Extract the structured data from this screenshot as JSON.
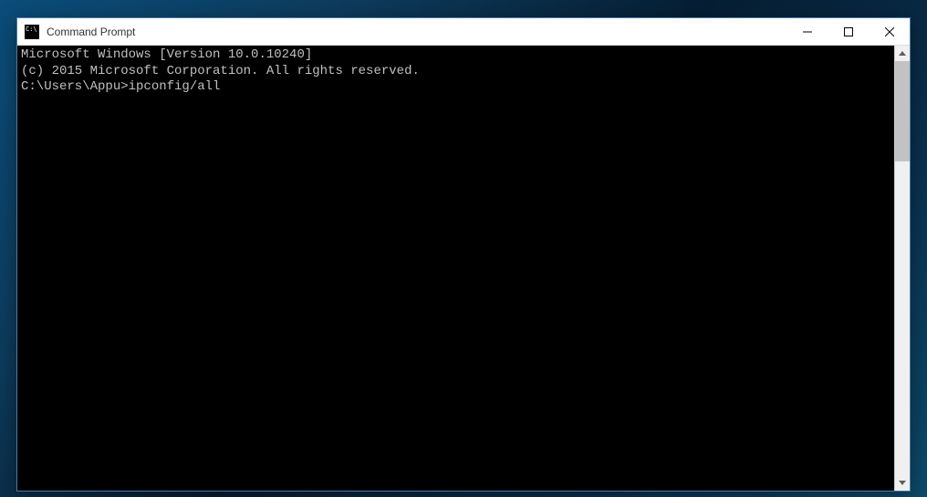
{
  "window": {
    "title": "Command Prompt"
  },
  "terminal": {
    "line1": "Microsoft Windows [Version 10.0.10240]",
    "line2": "(c) 2015 Microsoft Corporation. All rights reserved.",
    "blank": "",
    "prompt": "C:\\Users\\Appu>",
    "command": "ipconfig/all"
  }
}
